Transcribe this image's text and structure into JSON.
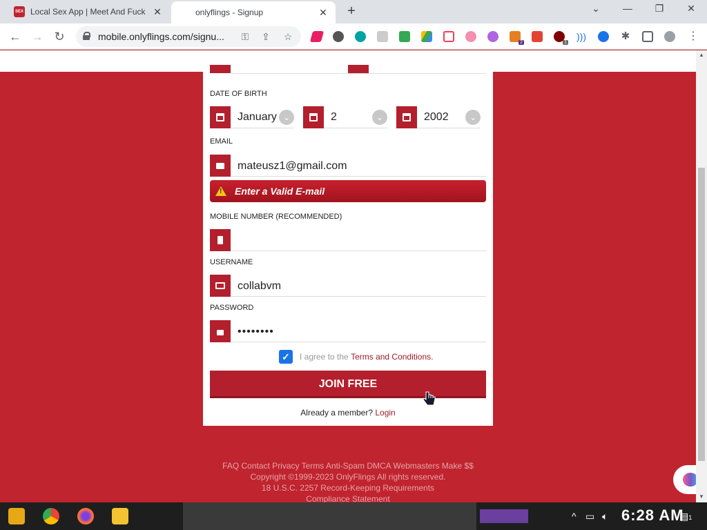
{
  "browser": {
    "tabs": [
      {
        "title": "Local Sex App | Meet And Fuck",
        "favicon": "SEX",
        "active": false
      },
      {
        "title": "onlyflings - Signup",
        "active": true
      }
    ],
    "url": "mobile.onlyflings.com/signu..."
  },
  "form": {
    "dob_label": "DATE OF BIRTH",
    "dob_month": "January",
    "dob_day": "2",
    "dob_year": "2002",
    "email_label": "EMAIL",
    "email_value": "mateusz1@gmail.com",
    "email_error": "Enter a Valid E-mail",
    "mobile_label": "MOBILE NUMBER (RECOMMENDED)",
    "mobile_value": "",
    "username_label": "USERNAME",
    "username_value": "collabvm",
    "password_label": "PASSWORD",
    "password_value": "••••••••",
    "agree_prefix": "I agree to the",
    "terms_link": "Terms and Conditions.",
    "agree_checked": true,
    "submit_label": "JOIN FREE",
    "member_text": "Already a member?",
    "login_link": "Login"
  },
  "footer": {
    "links": "FAQ Contact Privacy Terms Anti-Spam DMCA Webmasters Make $$",
    "copyright": "Copyright ©1999-2023 OnlyFlings All rights reserved.",
    "usc": "18 U.S.C. 2257 Record-Keeping Requirements",
    "compliance": "Compliance Statement"
  },
  "taskbar": {
    "clock": "6:28 AM",
    "notification_count": "1"
  },
  "colors": {
    "brand": "#c0242f",
    "brand_dark": "#b31f2c",
    "accent_link": "#9b1b27"
  }
}
